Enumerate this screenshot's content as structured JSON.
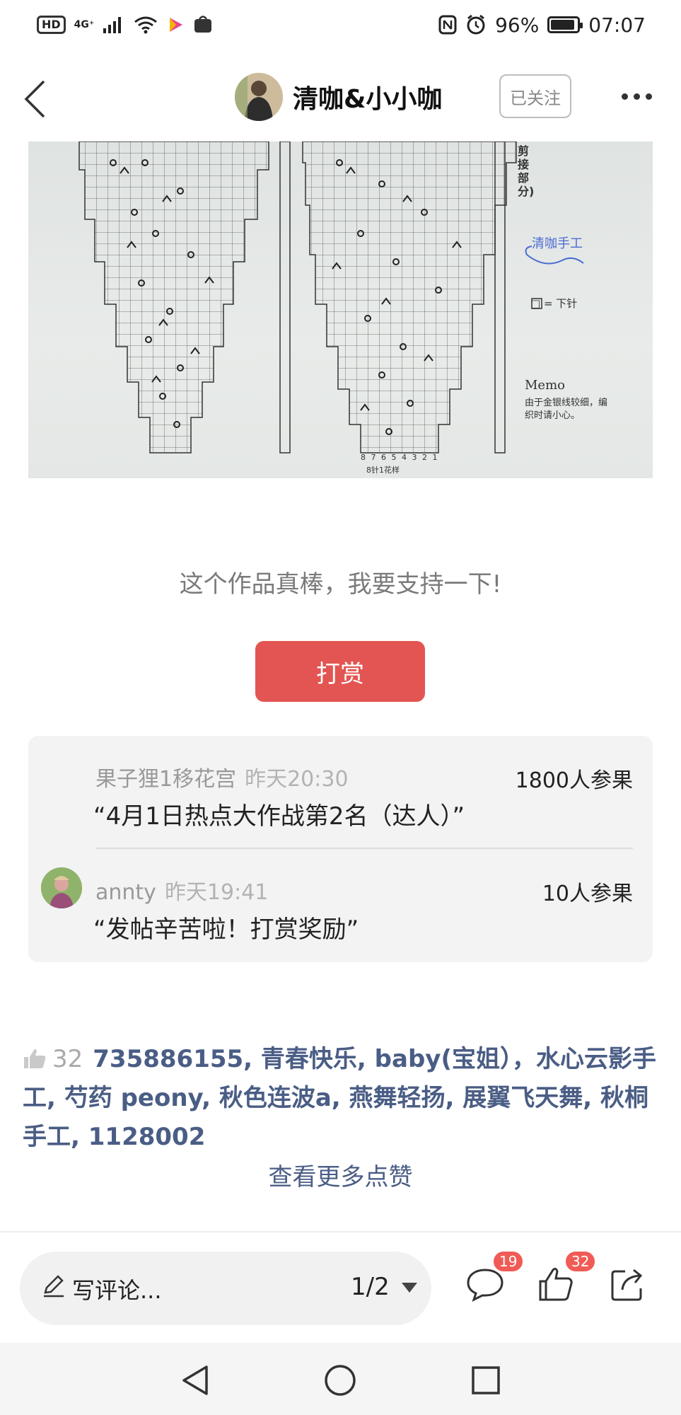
{
  "status_bar": {
    "left_badge": "HD",
    "network": "4G⁺",
    "battery": "96%",
    "time": "07:07"
  },
  "header": {
    "author_name": "清咖&小小咖",
    "follow_label": "已关注"
  },
  "chart_image": {
    "watermark": "清咖手工",
    "legend_symbol_text": "□ = 下针",
    "memo_title": "Memo",
    "memo_text_1": "由于金银线较细，编",
    "memo_text_2": "织时请小心。",
    "bottom_label": "8针1花样",
    "side_label": "剪接部分)",
    "bottom_numbers": "8 7 6 5 4 3 2 1"
  },
  "support": {
    "text": "这个作品真棒，我要支持一下!",
    "button_label": "打赏"
  },
  "rewards": [
    {
      "user": "果子狸1移花宫",
      "time": "昨天20:30",
      "count": "1800人参果",
      "message": "“4月1日热点大作战第2名（达人）”"
    },
    {
      "user": "annty",
      "time": "昨天19:41",
      "count": "10人参果",
      "message": "“发帖辛苦啦！打赏奖励”"
    }
  ],
  "likes": {
    "count": "32",
    "names": "735886155, 青春快乐, baby(宝姐），水心云影手工, 芍药 peony, 秋色连波a, 燕舞轻扬, 展翼飞天舞, 秋桐手工, 1128002",
    "more_label": "查看更多点赞"
  },
  "bottom_bar": {
    "comment_placeholder": "写评论...",
    "page_indicator": "1/2",
    "comment_badge": "19",
    "like_badge": "32"
  },
  "colors": {
    "accent_red": "#e35552",
    "link_blue": "#4a5d85",
    "badge_red": "#f05b55"
  }
}
